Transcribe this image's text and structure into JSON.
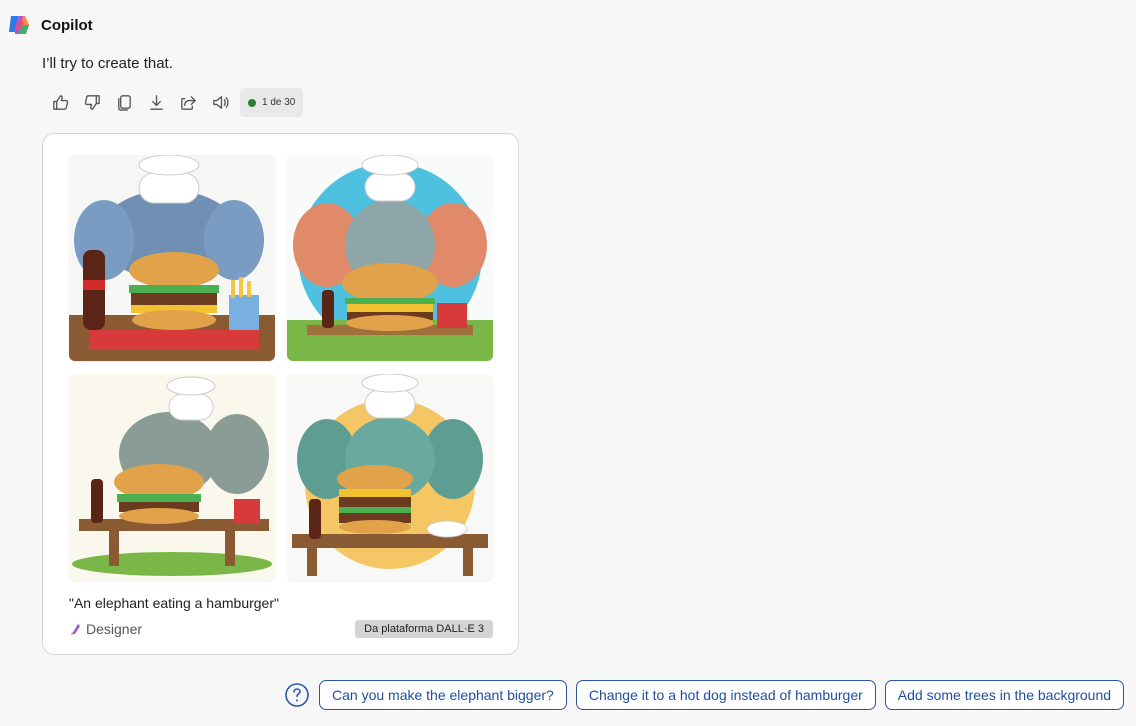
{
  "app": {
    "name": "Copilot"
  },
  "message": {
    "text": "I’ll try to create that."
  },
  "toolbar": {
    "actions": [
      "thumbs-up-icon",
      "thumbs-down-icon",
      "copy-icon",
      "download-icon",
      "share-icon",
      "speaker-icon"
    ],
    "counter": "1 de 30",
    "counter_color": "#2e7d32"
  },
  "card": {
    "caption": "\"An elephant eating a hamburger\"",
    "designer_label": "Designer",
    "platform_label": "Da plataforma DALL·E 3"
  },
  "suggestions": [
    "Can you make the elephant bigger?",
    "Change it to a hot dog instead of hamburger",
    "Add some trees in the background"
  ],
  "colors": {
    "accent": "#1f4f9c",
    "chip_border": "#2a55a8"
  }
}
